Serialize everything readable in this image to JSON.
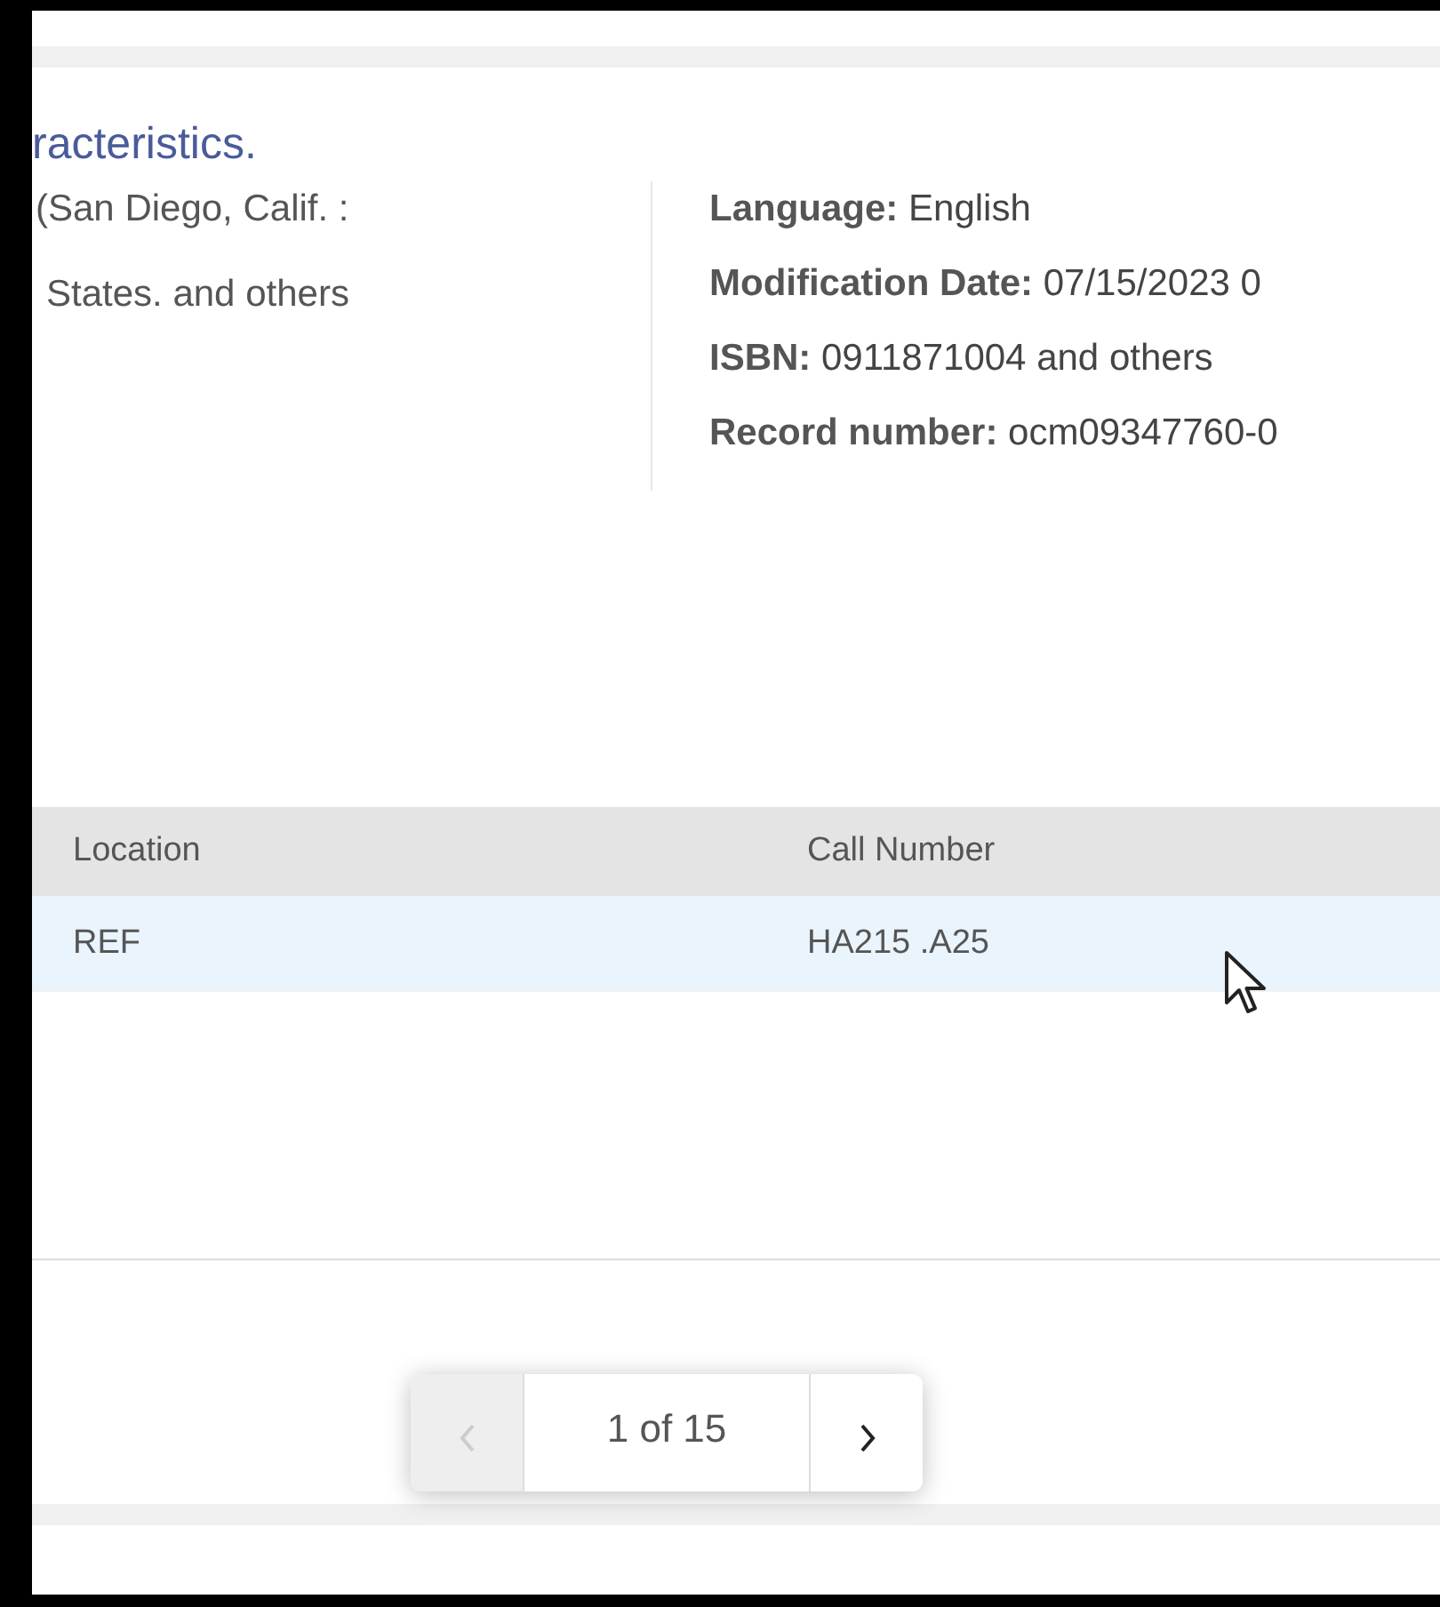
{
  "record": {
    "title": "racteristics.",
    "left_lines": [
      "(San Diego, Calif. :",
      "States. and others"
    ],
    "fields": [
      {
        "label": "Language:",
        "value": "English"
      },
      {
        "label": "Modification Date:",
        "value": "07/15/2023 0"
      },
      {
        "label": "ISBN:",
        "value": "0911871004 and others"
      },
      {
        "label": "Record number:",
        "value": "ocm09347760-0"
      }
    ]
  },
  "table": {
    "columns": [
      "Location",
      "Call Number"
    ],
    "rows": [
      {
        "cells": [
          "REF",
          "HA215 .A25"
        ],
        "highlighted": true
      }
    ]
  },
  "pagination": {
    "label": "1 of 15",
    "prev_disabled": true,
    "next_disabled": false
  }
}
